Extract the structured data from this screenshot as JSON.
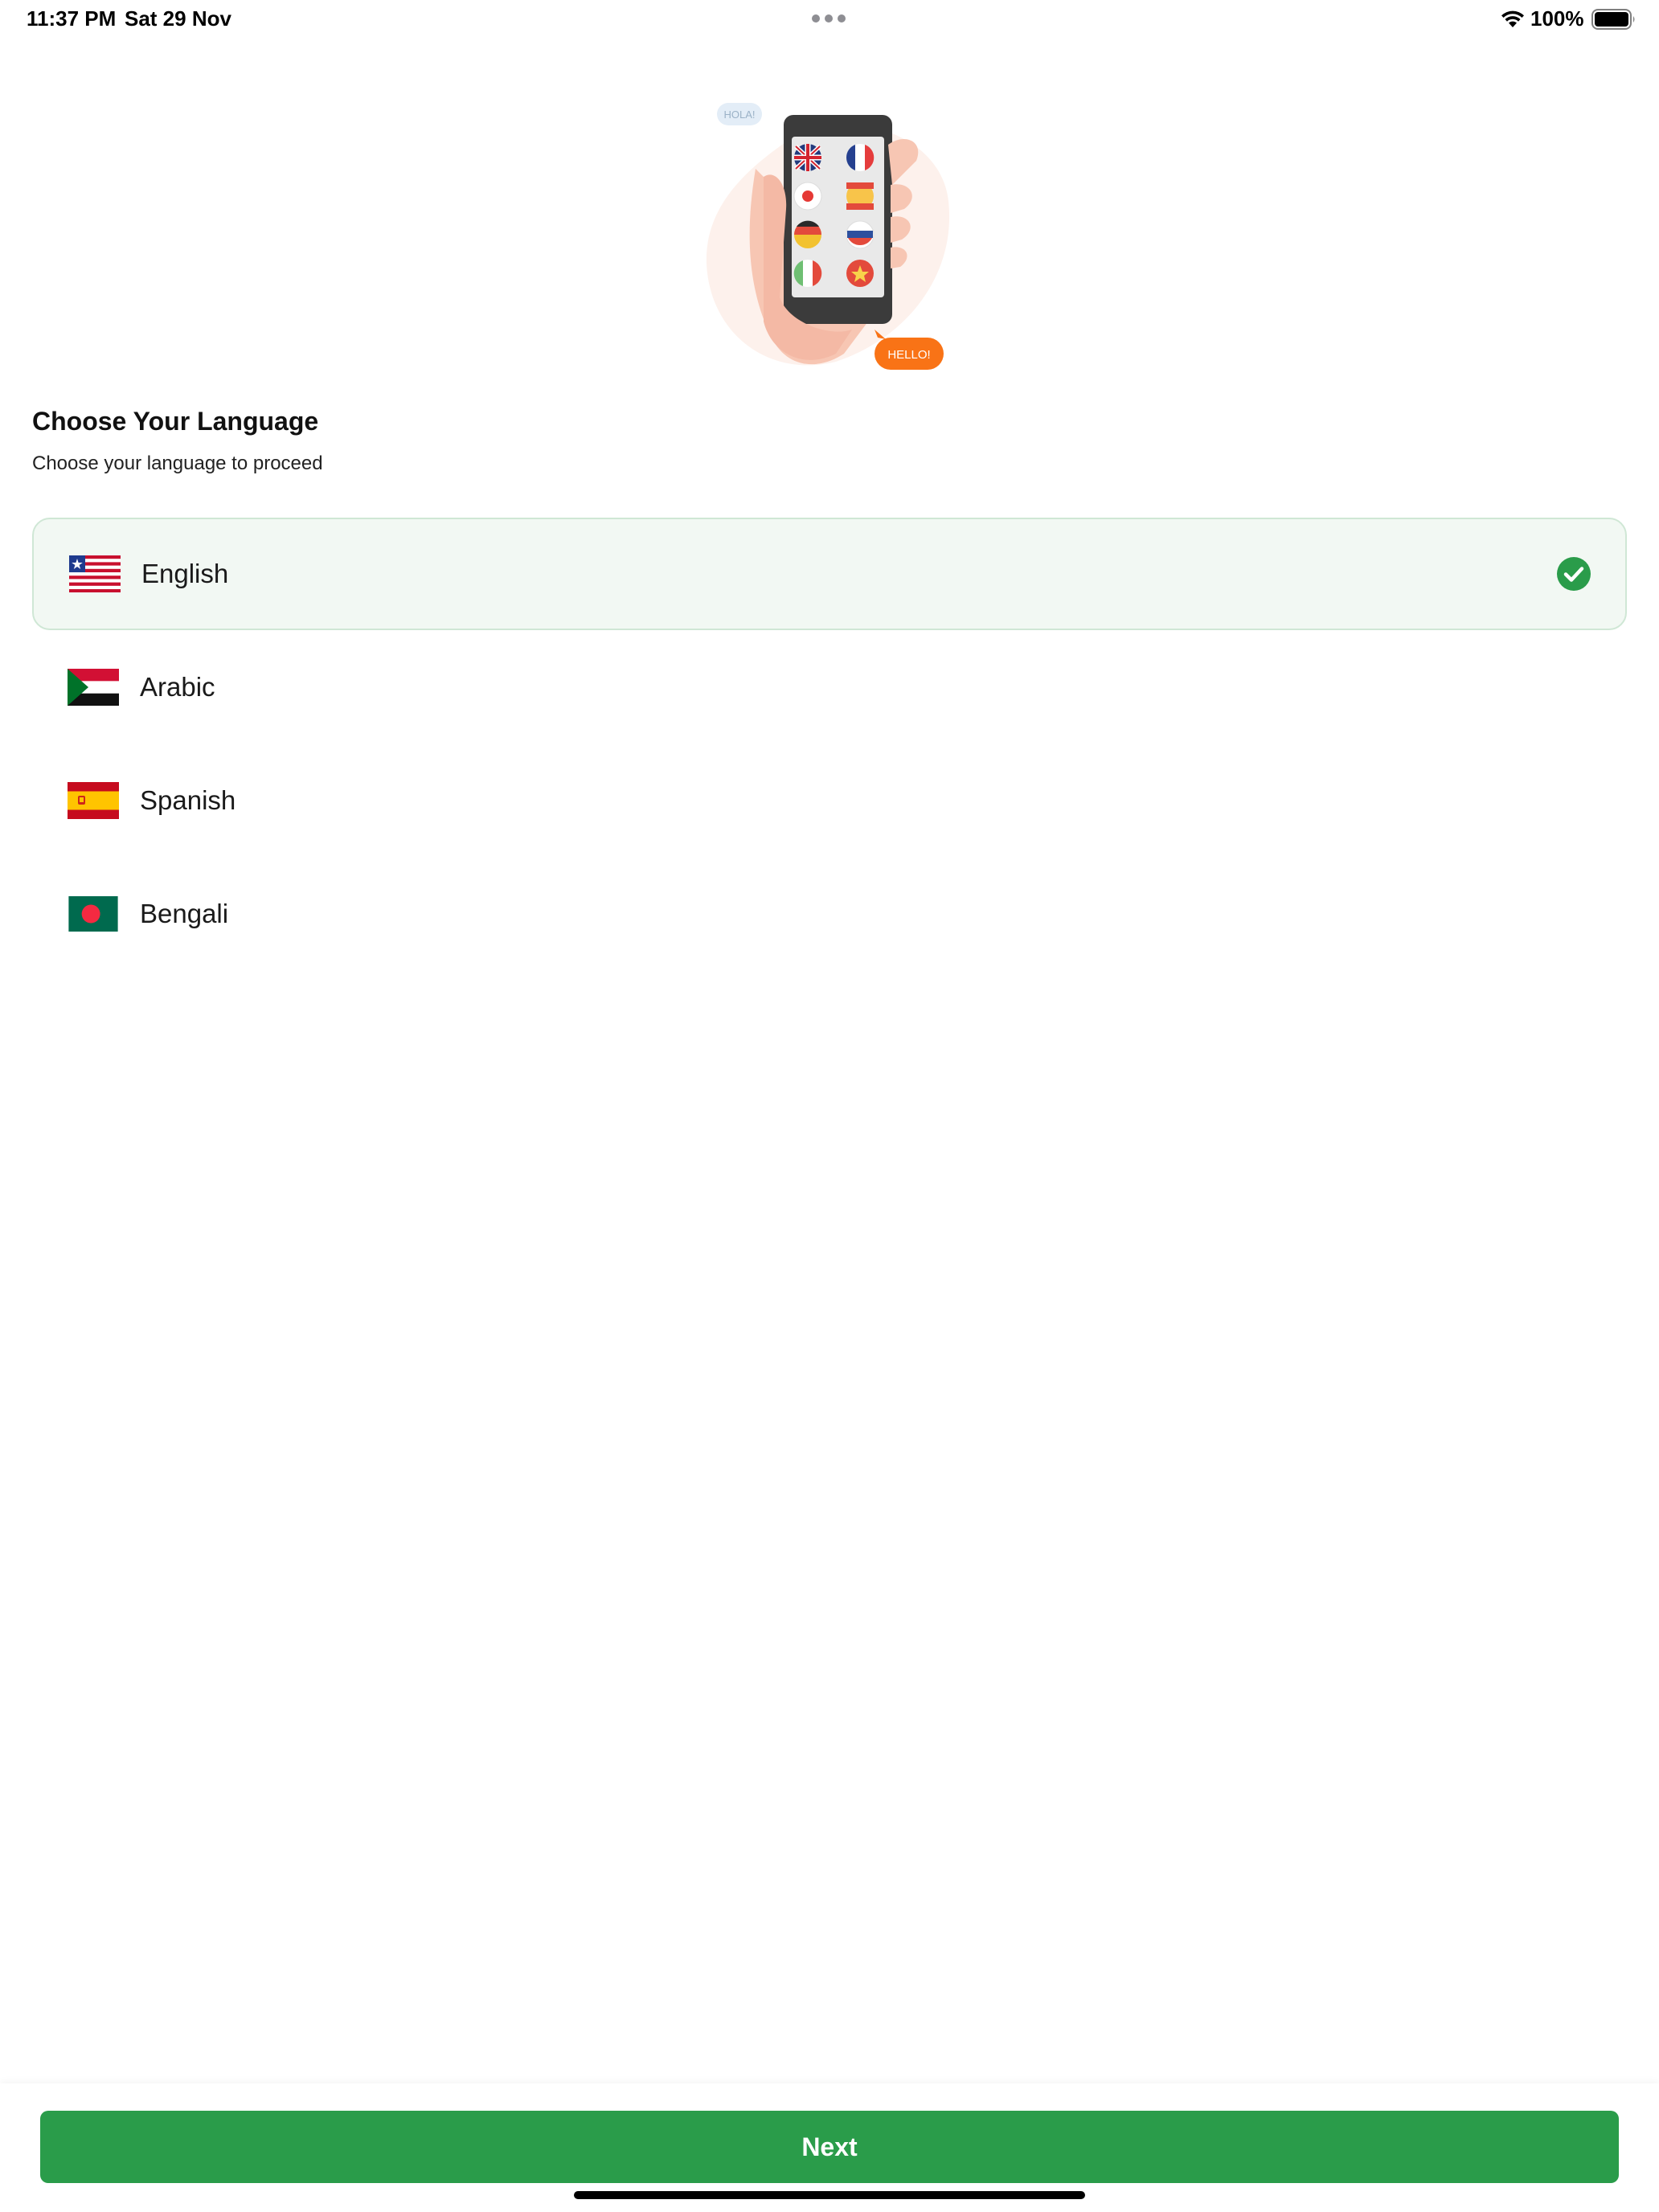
{
  "status_bar": {
    "time": "11:37 PM",
    "date": "Sat 29 Nov",
    "battery": "100%",
    "wifi_icon": "wifi-icon",
    "battery_icon": "battery-full-icon"
  },
  "illustration": {
    "bubble_left": "HOLA!",
    "bubble_right": "HELLO!",
    "accent": "#f97316"
  },
  "header": {
    "title": "Choose Your Language",
    "subtitle": "Choose your language to proceed"
  },
  "languages": [
    {
      "label": "English",
      "flag_icon": "liberia-flag-icon",
      "selected": true
    },
    {
      "label": "Arabic",
      "flag_icon": "sudan-flag-icon",
      "selected": false
    },
    {
      "label": "Spanish",
      "flag_icon": "spain-flag-icon",
      "selected": false
    },
    {
      "label": "Bengali",
      "flag_icon": "bangladesh-flag-icon",
      "selected": false
    }
  ],
  "footer": {
    "next_label": "Next"
  },
  "colors": {
    "primary": "#2a9c4a",
    "selected_bg": "#f2f8f3",
    "selected_border": "#cfe7d5"
  }
}
